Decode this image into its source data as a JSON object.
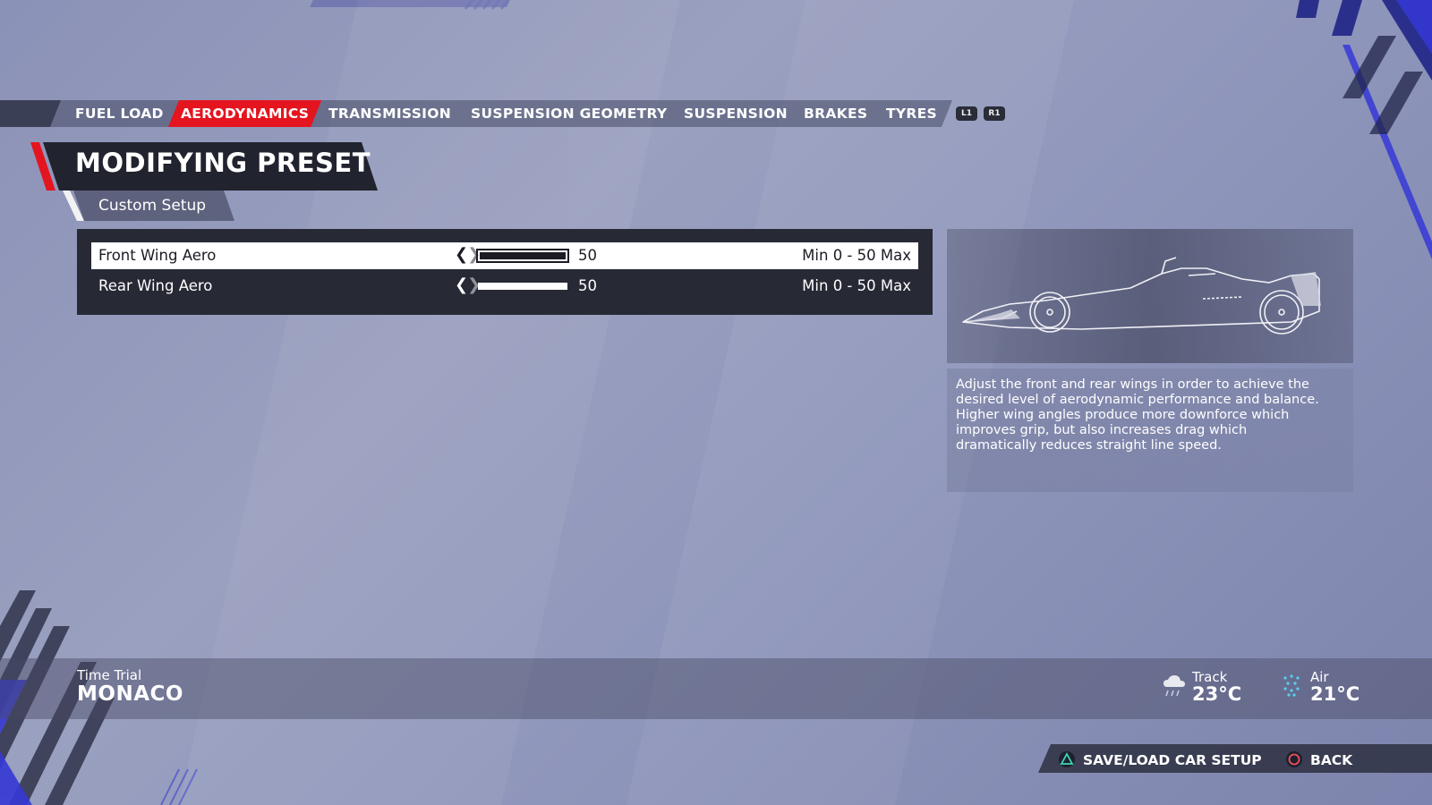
{
  "tabs": [
    {
      "label": "FUEL LOAD",
      "active": false
    },
    {
      "label": "AERODYNAMICS",
      "active": true
    },
    {
      "label": "TRANSMISSION",
      "active": false
    },
    {
      "label": "SUSPENSION GEOMETRY",
      "active": false
    },
    {
      "label": "SUSPENSION",
      "active": false
    },
    {
      "label": "BRAKES",
      "active": false
    },
    {
      "label": "TYRES",
      "active": false
    }
  ],
  "shoulder_buttons": {
    "left": "L1",
    "right": "R1"
  },
  "header": {
    "title": "MODIFYING PRESET",
    "subtitle": "Custom Setup"
  },
  "settings": [
    {
      "label": "Front Wing Aero",
      "value": "50",
      "level": 1.0,
      "range": "Min 0 - 50 Max",
      "selected": true
    },
    {
      "label": "Rear Wing Aero",
      "value": "50",
      "level": 1.0,
      "range": "Min 0 - 50 Max",
      "selected": false
    }
  ],
  "description": {
    "paragraph1": "Adjust the front and rear wings in order to achieve the desired level of aerodynamic performance and balance.",
    "paragraph2": "Higher wing angles produce more downforce which improves grip, but also increases drag which dramatically reduces straight line speed."
  },
  "session": {
    "mode": "Time Trial",
    "track": "MONACO"
  },
  "weather": {
    "track_label": "Track",
    "track_temp": "23°C",
    "track_icon": "rain-cloud-icon",
    "air_label": "Air",
    "air_temp": "21°C",
    "air_icon": "snow-icon"
  },
  "prompts": {
    "save_label": "SAVE/LOAD CAR SETUP",
    "save_icon": "triangle-button-icon",
    "back_label": "BACK",
    "back_icon": "circle-button-icon"
  },
  "colors": {
    "accent": "#e4151f",
    "panel_dark": "#272935",
    "background": "#8f96bb"
  }
}
